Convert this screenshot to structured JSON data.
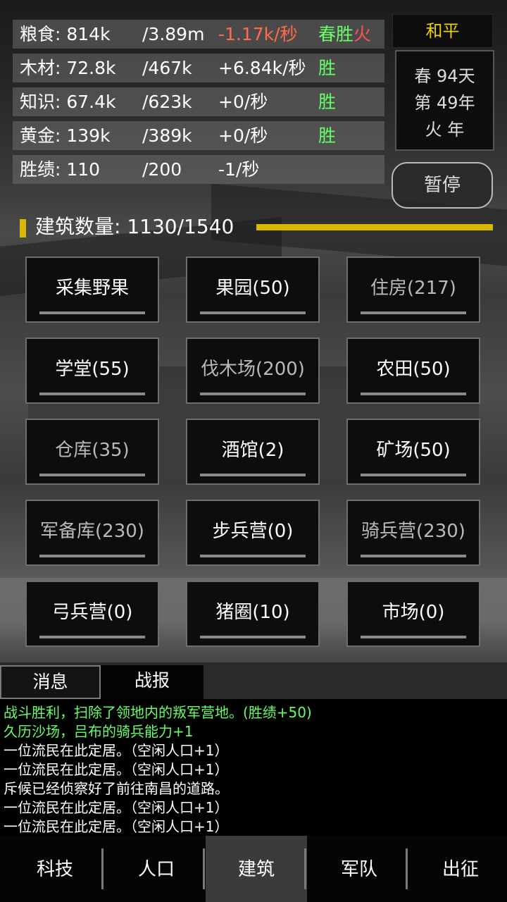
{
  "resources": [
    {
      "name": "粮食: 814k",
      "cap": "/3.89m",
      "rate": "-1.17k/秒",
      "rate_negative": true,
      "tag_main": "春胜",
      "tag_extra": "火"
    },
    {
      "name": "木材: 72.8k",
      "cap": "/467k",
      "rate": "+6.84k/秒",
      "rate_negative": false,
      "tag_main": "胜",
      "tag_extra": ""
    },
    {
      "name": "知识: 67.4k",
      "cap": "/623k",
      "rate": "+0/秒",
      "rate_negative": false,
      "tag_main": "胜",
      "tag_extra": ""
    },
    {
      "name": "黄金: 139k",
      "cap": "/389k",
      "rate": "+0/秒",
      "rate_negative": false,
      "tag_main": "胜",
      "tag_extra": ""
    },
    {
      "name": "胜绩: 110",
      "cap": "/200",
      "rate": "-1/秒",
      "rate_negative": false,
      "tag_main": "",
      "tag_extra": ""
    }
  ],
  "status": {
    "state": "和平",
    "season_day": "春 94天",
    "year": "第 49年",
    "year_element": "火 年",
    "pause_label": "暂停"
  },
  "buildings_header": "建筑数量: 1130/1540",
  "buildings": [
    {
      "label": "采集野果",
      "dim": false
    },
    {
      "label": "果园(50)",
      "dim": false
    },
    {
      "label": "住房(217)",
      "dim": true
    },
    {
      "label": "学堂(55)",
      "dim": false
    },
    {
      "label": "伐木场(200)",
      "dim": true
    },
    {
      "label": "农田(50)",
      "dim": false
    },
    {
      "label": "仓库(35)",
      "dim": true
    },
    {
      "label": "酒馆(2)",
      "dim": false
    },
    {
      "label": "矿场(50)",
      "dim": false
    },
    {
      "label": "军备库(230)",
      "dim": true
    },
    {
      "label": "步兵营(0)",
      "dim": false
    },
    {
      "label": "骑兵营(230)",
      "dim": true
    },
    {
      "label": "弓兵营(0)",
      "dim": false
    },
    {
      "label": "猪圈(10)",
      "dim": false
    },
    {
      "label": "市场(0)",
      "dim": false
    }
  ],
  "message_tabs": [
    "消息",
    "战报"
  ],
  "messages": [
    {
      "text": "战斗胜利，扫除了领地内的叛军营地。(胜绩+50)",
      "color": "#66ff66"
    },
    {
      "text": "久历沙场，吕布的骑兵能力+1",
      "color": "#66ff66"
    },
    {
      "text": "一位流民在此定居。（空闲人口+1）",
      "color": "#ffffff"
    },
    {
      "text": "一位流民在此定居。（空闲人口+1）",
      "color": "#ffffff"
    },
    {
      "text": "斥候已经侦察好了前往南昌的道路。",
      "color": "#ffffff"
    },
    {
      "text": "一位流民在此定居。（空闲人口+1）",
      "color": "#ffffff"
    },
    {
      "text": "一位流民在此定居。（空闲人口+1）",
      "color": "#ffffff"
    }
  ],
  "nav": [
    {
      "label": "科技",
      "active": false
    },
    {
      "label": "人口",
      "active": false
    },
    {
      "label": "建筑",
      "active": true
    },
    {
      "label": "军队",
      "active": false
    },
    {
      "label": "出征",
      "active": false
    }
  ],
  "colors": {
    "accent_yellow": "#d8b800",
    "positive_green": "#66ff66",
    "negative_red": "#ff6c4a"
  }
}
